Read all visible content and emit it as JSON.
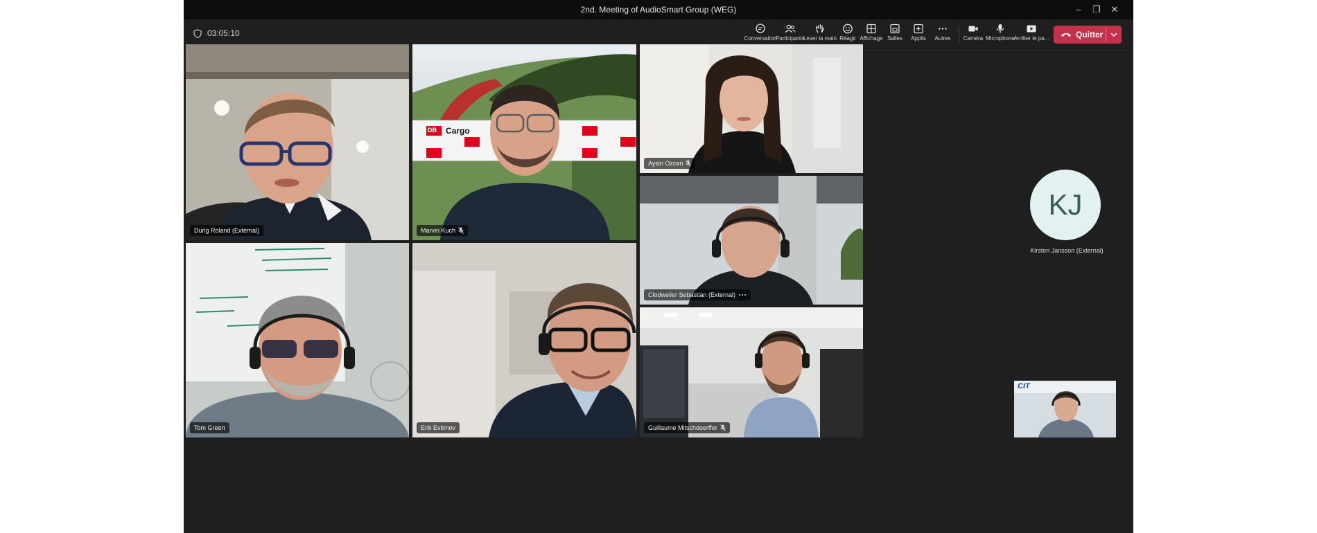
{
  "window": {
    "title": "2nd. Meeting of AudioSmart Group (WEG)",
    "controls": {
      "minimize": "–",
      "restore": "❐",
      "close": "✕"
    }
  },
  "toolbar": {
    "timer": "03:05:10",
    "buttons": [
      {
        "label": "Conversation",
        "icon": "chat-icon"
      },
      {
        "label": "Participants",
        "icon": "people-icon"
      },
      {
        "label": "Lever la main",
        "icon": "raise-hand-icon"
      },
      {
        "label": "Réagir",
        "icon": "react-icon"
      },
      {
        "label": "Affichage",
        "icon": "view-icon"
      },
      {
        "label": "Salles",
        "icon": "rooms-icon"
      },
      {
        "label": "Applis",
        "icon": "apps-icon"
      },
      {
        "label": "Autres",
        "icon": "more-icon"
      },
      {
        "label": "Caméra",
        "icon": "camera-icon"
      },
      {
        "label": "Microphone",
        "icon": "microphone-icon"
      },
      {
        "label": "Arrêter le pa...",
        "icon": "share-icon"
      }
    ],
    "leave": "Quitter"
  },
  "participants": [
    {
      "name": "Durig Roland (External)",
      "muted": false,
      "more": false
    },
    {
      "name": "Marvin Kuch",
      "muted": true,
      "more": false,
      "background_text": "Cargo",
      "background_logo": "DB"
    },
    {
      "name": "Aysin Ozcan",
      "muted": true,
      "more": false
    },
    {
      "name": "Tom Green",
      "muted": false,
      "more": false
    },
    {
      "name": "Erik Evtimov",
      "muted": false,
      "more": false,
      "active_speaker": true
    },
    {
      "name": "Clodweiler Sebastian (External)",
      "muted": false,
      "more": true
    },
    {
      "name": "Guillaume Mitschdoerffer",
      "muted": true,
      "more": false
    }
  ],
  "avatar": {
    "initials": "KJ",
    "name": "Kirsten Jansson (External)"
  },
  "self_view": {
    "logo": "CIT"
  },
  "colors": {
    "leave": "#c4314b",
    "avatar_bg": "#e3f2f1",
    "window_bg": "#1f1f1f"
  }
}
